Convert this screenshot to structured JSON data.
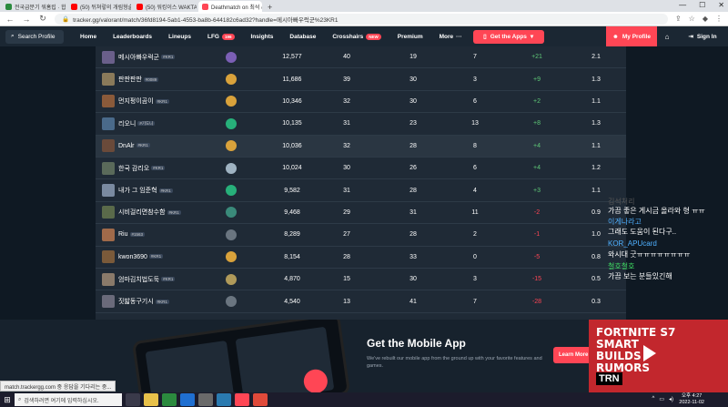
{
  "browser": {
    "tabs": [
      {
        "title": "전국급분기 워홈립 · 합법 기"
      },
      {
        "title": "(50) 뒤쳐렇의 개림형술 · YouTu"
      },
      {
        "title": "(50) 워킹이스 WAKTAVERSE · Yo"
      },
      {
        "title": "Deathmatch on 최석 @ 11/02"
      }
    ],
    "active_tab": 3,
    "url": "tracker.gg/valorant/match/36fd8194-5ab1-4553-ba8b-644182c6ad32?handle=메시아빠우럭군%23KR1"
  },
  "nav": {
    "search": "Search Profile",
    "items": [
      "Home",
      "Leaderboards",
      "Lineups",
      "LFG",
      "Insights",
      "Database",
      "Crosshairs",
      "Premium",
      "More"
    ],
    "lfg_badge": "196",
    "crosshairs_badge": "NEW",
    "get_apps": "Get the Apps",
    "my_profile": "My Profile",
    "sign_in": "Sign In"
  },
  "players": [
    {
      "name": "메시아빠우럭군",
      "tag": "#KR1",
      "rank_color": "#7b5fb5",
      "avatar": "#6a5f8a",
      "c1": "12,577",
      "c2": "40",
      "c3": "19",
      "c4": "7",
      "diff": "+21",
      "ratio": "2.1"
    },
    {
      "name": "판판판판",
      "tag": "#0089",
      "rank_color": "#d9a23b",
      "avatar": "#8a7a5a",
      "c1": "11,686",
      "c2": "39",
      "c3": "30",
      "c4": "3",
      "diff": "+9",
      "ratio": "1.3"
    },
    {
      "name": "먼지펑이곰이",
      "tag": "#KR1",
      "rank_color": "#d9a23b",
      "avatar": "#8a5a3a",
      "c1": "10,346",
      "c2": "32",
      "c3": "30",
      "c4": "6",
      "diff": "+2",
      "ratio": "1.1"
    },
    {
      "name": "리오니",
      "tag": "#기도니",
      "rank_color": "#27b07a",
      "avatar": "#4a6a8a",
      "c1": "10,135",
      "c2": "31",
      "c3": "23",
      "c4": "13",
      "diff": "+8",
      "ratio": "1.3"
    },
    {
      "name": "DnAlr",
      "tag": "#KR1",
      "rank_color": "#d9a23b",
      "avatar": "#6a4a3a",
      "c1": "10,036",
      "c2": "32",
      "c3": "28",
      "c4": "8",
      "diff": "+4",
      "ratio": "1.1"
    },
    {
      "name": "한국 감리오",
      "tag": "#KR1",
      "rank_color": "#9fb3c2",
      "avatar": "#5a6a5a",
      "c1": "10,024",
      "c2": "30",
      "c3": "26",
      "c4": "6",
      "diff": "+4",
      "ratio": "1.2"
    },
    {
      "name": "내가 그 임준혁",
      "tag": "#KR1",
      "rank_color": "#27b07a",
      "avatar": "#7a8aa0",
      "c1": "9,582",
      "c2": "31",
      "c3": "28",
      "c4": "4",
      "diff": "+3",
      "ratio": "1.1"
    },
    {
      "name": "시비걸리면참수함",
      "tag": "#KR1",
      "rank_color": "#3a8a7a",
      "avatar": "#5a6a4a",
      "c1": "9,468",
      "c2": "29",
      "c3": "31",
      "c4": "11",
      "diff": "-2",
      "ratio": "0.9"
    },
    {
      "name": "Riu",
      "tag": "#1563",
      "rank_color": "#6a7580",
      "avatar": "#a06a4a",
      "c1": "8,289",
      "c2": "27",
      "c3": "28",
      "c4": "2",
      "diff": "-1",
      "ratio": "1.0"
    },
    {
      "name": "kwon3690",
      "tag": "#KR1",
      "rank_color": "#d9a23b",
      "avatar": "#7a5a3a",
      "c1": "8,154",
      "c2": "28",
      "c3": "33",
      "c4": "0",
      "diff": "-5",
      "ratio": "0.8"
    },
    {
      "name": "엄마김치법도둑",
      "tag": "#KR1",
      "rank_color": "#b09a5a",
      "avatar": "#8a7a6a",
      "c1": "4,870",
      "c2": "15",
      "c3": "30",
      "c4": "3",
      "diff": "-15",
      "ratio": "0.5"
    },
    {
      "name": "짓밟동구기시",
      "tag": "#KR1",
      "rank_color": "#6a7580",
      "avatar": "#6a6a7a",
      "c1": "4,540",
      "c2": "13",
      "c3": "41",
      "c4": "7",
      "diff": "-28",
      "ratio": "0.3"
    }
  ],
  "chat": [
    {
      "name": "",
      "text": "김석처리",
      "faint": true
    },
    {
      "name": "",
      "text": "가끔 좋은 게시금 올라와 형 ㅠㅠ"
    },
    {
      "name": "이게나라고",
      "text": ""
    },
    {
      "name": "",
      "text": "그래도 도움이 된다구.."
    },
    {
      "name": "KOR_APUcard",
      "text": ""
    },
    {
      "name": "",
      "text": "와시대 굿ㅠㅠㅠㅠㅠㅠㅠㅠ"
    },
    {
      "name": "철호철호",
      "text": "",
      "green": true
    },
    {
      "name": "",
      "text": "가끔 보는 분들있긴해"
    }
  ],
  "promo": {
    "title": "Get the Mobile App",
    "desc": "We've rebuilt our mobile app from the ground up with your favorite features and games.",
    "cta": "Learn More",
    "ad_title": "FORTNITE S7 SMART BUILDS RUMORS",
    "ad_brand": "TRN"
  },
  "status_url": "match.trackergg.com 중 응답을 기다리는 중...",
  "taskbar": {
    "search": "검색하려면 여기에 입력하십시오.",
    "time": "오후 4:27",
    "date": "2022-11-02"
  }
}
